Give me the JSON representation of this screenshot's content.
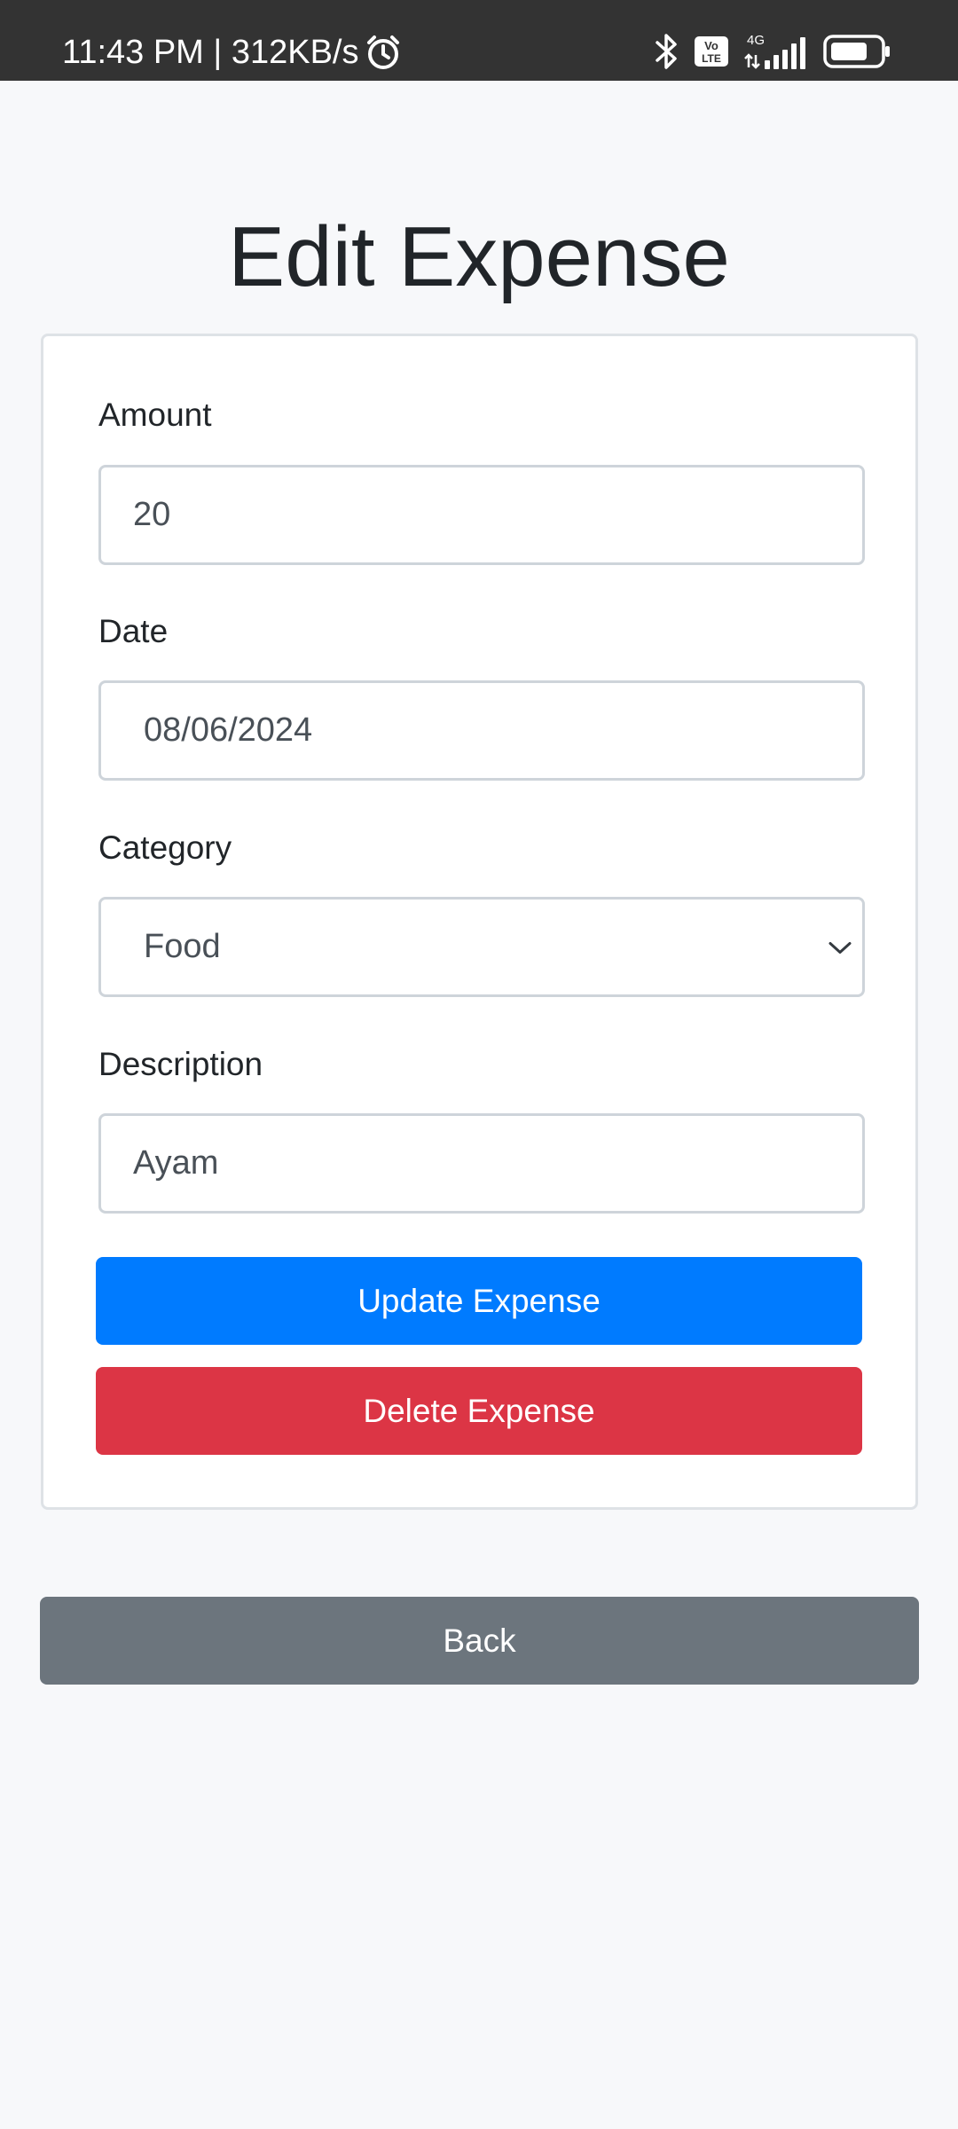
{
  "status_bar": {
    "time_speed": "11:43 PM | 312KB/s",
    "alarm_icon": "alarm-clock-icon",
    "bluetooth_icon": "bluetooth-icon",
    "volte_badge": "Vo LTE",
    "network_type": "4G",
    "signal_icon": "signal-bars-icon",
    "battery_icon": "battery-icon",
    "battery_level": 0.65
  },
  "page": {
    "title": "Edit Expense"
  },
  "form": {
    "amount": {
      "label": "Amount",
      "value": "20"
    },
    "date": {
      "label": "Date",
      "value": "08/06/2024"
    },
    "category": {
      "label": "Category",
      "value": "Food",
      "icon": "chevron-down-icon"
    },
    "description": {
      "label": "Description",
      "value": "Ayam"
    },
    "update_label": "Update Expense",
    "delete_label": "Delete Expense"
  },
  "back_label": "Back",
  "colors": {
    "primary": "#007bff",
    "danger": "#dc3545",
    "secondary": "#6c757d",
    "background": "#f7f8fa",
    "status_bar": "#333333"
  }
}
